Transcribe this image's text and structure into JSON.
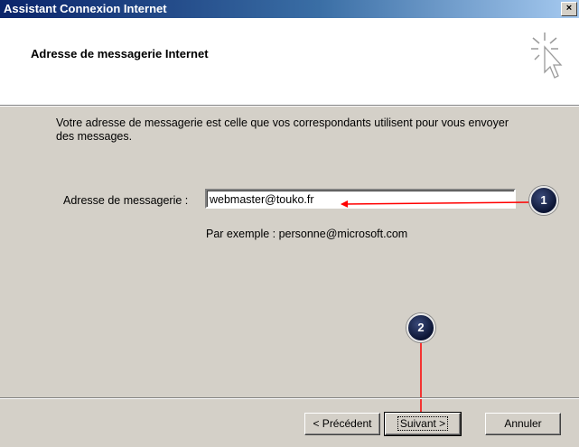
{
  "window": {
    "title": "Assistant Connexion Internet",
    "close_label": "×"
  },
  "header": {
    "title": "Adresse de messagerie Internet",
    "icon": "wizard-cursor-icon"
  },
  "main": {
    "intro": "Votre adresse de messagerie est celle que vos correspondants utilisent pour vous envoyer des messages.",
    "email_label": "Adresse de messagerie :",
    "email_value": "webmaster@touko.fr",
    "example_text": "Par exemple : personne@microsoft.com"
  },
  "annotations": {
    "step1": "1",
    "step2": "2",
    "arrow_color": "#ff0000"
  },
  "footer": {
    "back_label": "< Précédent",
    "next_label": "Suivant >",
    "cancel_label": "Annuler"
  }
}
